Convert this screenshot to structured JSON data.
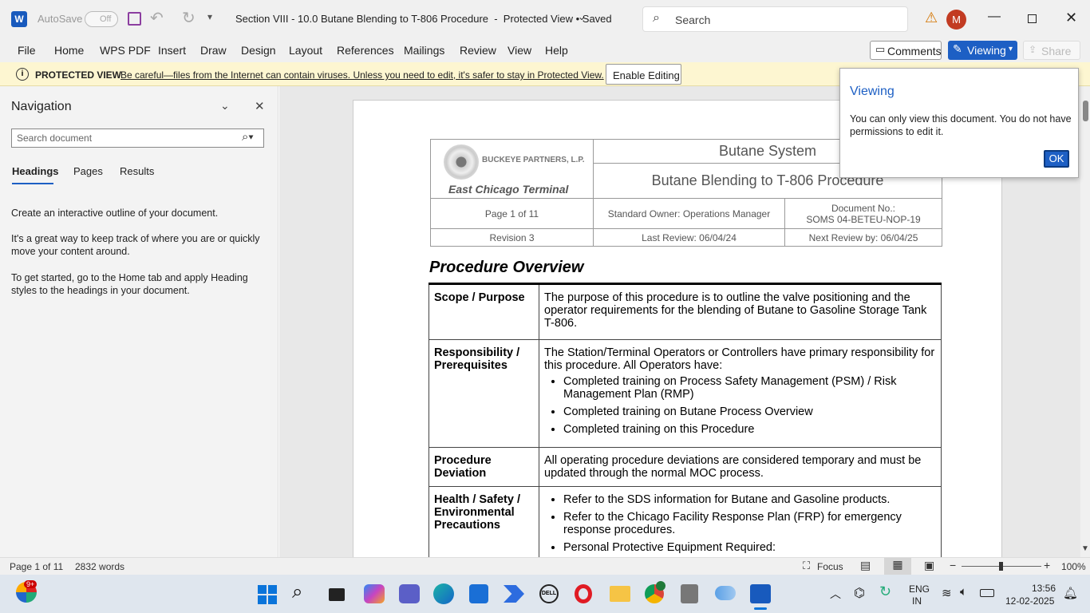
{
  "titlebar": {
    "autosave": "AutoSave",
    "autosave_state": "Off",
    "doc_title": "Section VIII - 10.0 Butane Blending to T-806 Procedure  -  Protected View • Saved",
    "search": "Search",
    "avatar": "M"
  },
  "ribbon": {
    "tabs": [
      "File",
      "Home",
      "WPS PDF",
      "Insert",
      "Draw",
      "Design",
      "Layout",
      "References",
      "Mailings",
      "Review",
      "View",
      "Help"
    ],
    "comments": "Comments",
    "viewing": "Viewing",
    "share": "Share"
  },
  "protected": {
    "label": "PROTECTED VIEW",
    "message": "Be careful—files from the Internet can contain viruses. Unless you need to edit, it's safer to stay in Protected View.",
    "button": "Enable Editing"
  },
  "popup": {
    "title": "Viewing",
    "text": "You can only view this document. You do not have permissions to edit it.",
    "ok": "OK"
  },
  "nav": {
    "title": "Navigation",
    "search_placeholder": "Search document",
    "tabs": [
      "Headings",
      "Pages",
      "Results"
    ],
    "p1": "Create an interactive outline of your document.",
    "p2": "It's a great way to keep track of where you are or quickly move your content around.",
    "p3": "To get started, go to the Home tab and apply Heading styles to the headings in your document."
  },
  "doc": {
    "company": "BUCKEYE PARTNERS, L.P.",
    "terminal": "East Chicago Terminal",
    "system": "Butane System",
    "procedure": "Butane Blending to T-806 Procedure",
    "page": "Page 1 of 11",
    "owner": "Standard Owner: Operations Manager",
    "docno_label": "Document No.:",
    "docno": "SOMS 04-BETEU-NOP-19",
    "revision": "Revision 3",
    "last_review": "Last Review: 06/04/24",
    "next_review": "Next Review by: 06/04/25",
    "overview": "Procedure Overview",
    "rows": [
      {
        "label": "Scope / Purpose",
        "text": "The purpose of this procedure is to outline the valve positioning and the operator requirements for the blending of Butane to Gasoline Storage Tank T-806.",
        "bullets": []
      },
      {
        "label": "Responsibility / Prerequisites",
        "text": "The Station/Terminal Operators or Controllers have primary responsibility for this procedure.  All Operators have:",
        "bullets": [
          "Completed training on Process Safety Management (PSM) / Risk Management Plan (RMP)",
          "Completed training on Butane Process Overview",
          "Completed training on this Procedure"
        ]
      },
      {
        "label": "Procedure Deviation",
        "text": "All operating procedure deviations are considered temporary and must be updated through the normal MOC process.",
        "bullets": []
      },
      {
        "label": "Health / Safety / Environmental Precautions",
        "text": "",
        "bullets": [
          "Refer to the SDS information for Butane and Gasoline products.",
          "Refer to the Chicago Facility Response Plan (FRP) for emergency response procedures.",
          "Personal Protective Equipment Required:"
        ]
      }
    ]
  },
  "status": {
    "page": "Page 1 of 11",
    "words": "2832 words",
    "focus": "Focus",
    "zoom": "100%"
  },
  "taskbar": {
    "badge": "9+",
    "lang1": "ENG",
    "lang2": "IN",
    "time": "13:56",
    "date": "12-02-2025"
  }
}
